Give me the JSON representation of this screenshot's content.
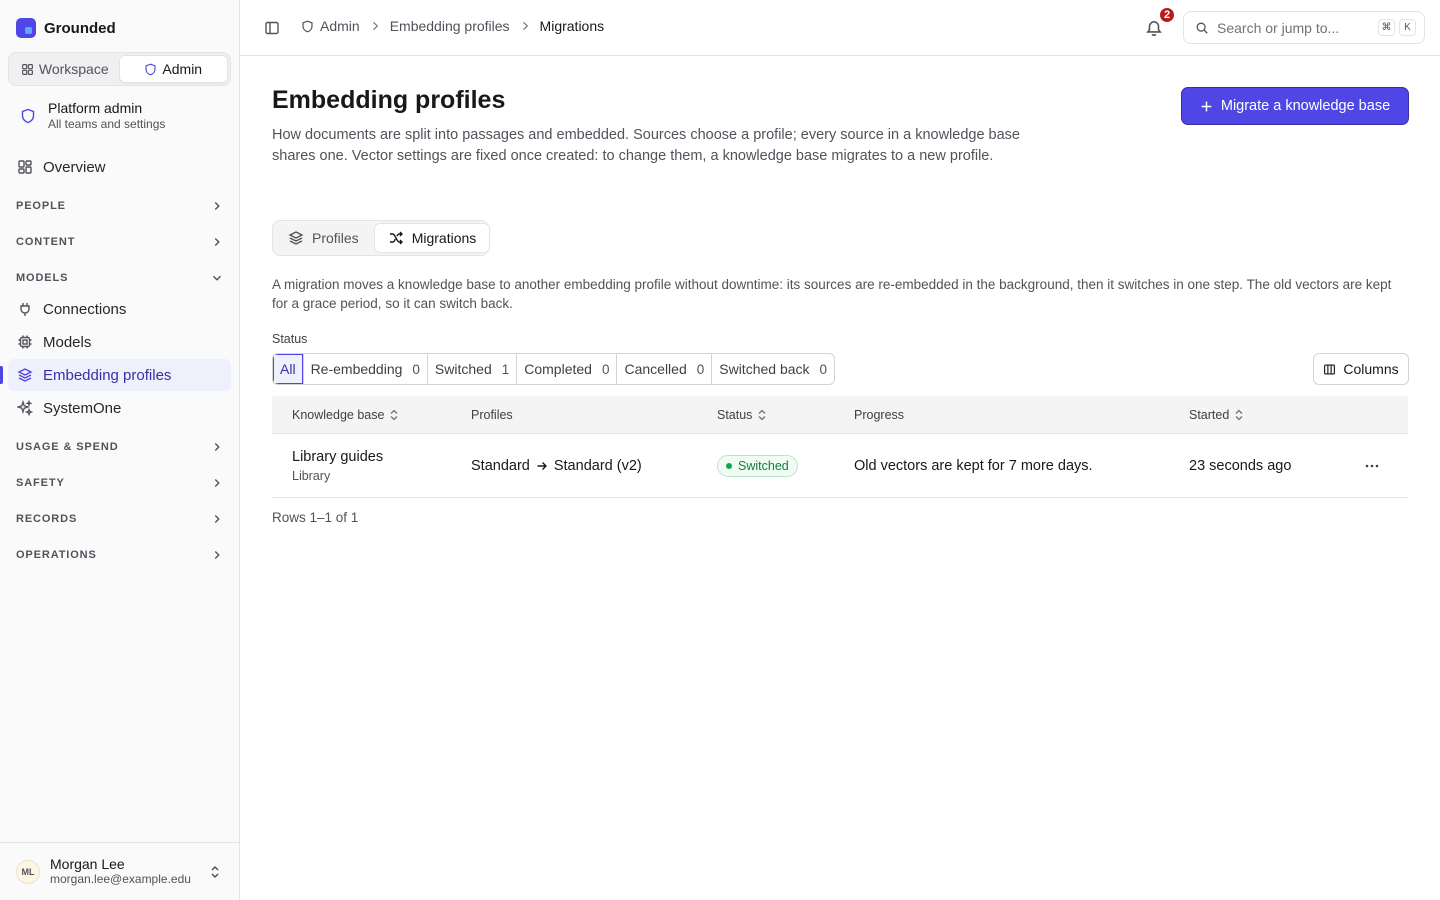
{
  "app": {
    "name": "Grounded",
    "colors": {
      "accent": "#4f46e5",
      "accent_soft": "#eef0fb",
      "success": "#16a34a",
      "danger": "#b91c1c"
    }
  },
  "sidebar": {
    "modes": [
      {
        "label": "Workspace",
        "icon": "grid-icon",
        "active": false
      },
      {
        "label": "Admin",
        "icon": "shield-icon",
        "active": true
      }
    ],
    "scope": {
      "title": "Platform admin",
      "subtitle": "All teams and settings",
      "icon": "shield-icon"
    },
    "overview": {
      "label": "Overview",
      "icon": "dashboard-icon"
    },
    "sections": {
      "people": "PEOPLE",
      "content": "CONTENT",
      "models": "MODELS",
      "usage": "USAGE & SPEND",
      "safety": "SAFETY",
      "records": "RECORDS",
      "operations": "OPERATIONS"
    },
    "models_items": [
      {
        "label": "Connections",
        "icon": "plug-icon",
        "active": false
      },
      {
        "label": "Models",
        "icon": "cpu-icon",
        "active": false
      },
      {
        "label": "Embedding profiles",
        "icon": "layers-icon",
        "active": true
      },
      {
        "label": "SystemOne",
        "icon": "sparkles-icon",
        "active": false
      }
    ],
    "user": {
      "initials": "ML",
      "name": "Morgan Lee",
      "email": "morgan.lee@example.edu"
    }
  },
  "topbar": {
    "breadcrumbs": [
      "Admin",
      "Embedding profiles",
      "Migrations"
    ],
    "notifications_count": "2",
    "search": {
      "placeholder": "Search or jump to...",
      "kbd1": "⌘",
      "kbd2": "K"
    }
  },
  "page": {
    "title": "Embedding profiles",
    "description": "How documents are split into passages and embedded. Sources choose a profile; every source in a knowledge base shares one. Vector settings are fixed once created: to change them, a knowledge base migrates to a new profile.",
    "primary_action": "Migrate a knowledge base",
    "tabs": [
      {
        "label": "Profiles",
        "icon": "layers-icon",
        "active": false
      },
      {
        "label": "Migrations",
        "icon": "shuffle-icon",
        "active": true
      }
    ],
    "intro": "A migration moves a knowledge base to another embedding profile without downtime: its sources are re-embedded in the background, then it switches in one step. The old vectors are kept for a grace period, so it can switch back."
  },
  "filters": {
    "label": "Status",
    "options": [
      {
        "label": "All",
        "count": "",
        "active": true
      },
      {
        "label": "Re-embedding",
        "count": "0",
        "active": false
      },
      {
        "label": "Switched",
        "count": "1",
        "active": false
      },
      {
        "label": "Completed",
        "count": "0",
        "active": false
      },
      {
        "label": "Cancelled",
        "count": "0",
        "active": false
      },
      {
        "label": "Switched back",
        "count": "0",
        "active": false
      }
    ],
    "columns_button": "Columns"
  },
  "table": {
    "headers": {
      "knowledge_base": "Knowledge base",
      "profiles": "Profiles",
      "status": "Status",
      "progress": "Progress",
      "started": "Started"
    },
    "rows": [
      {
        "name": "Library guides",
        "team": "Library",
        "from_profile": "Standard",
        "to_profile": "Standard (v2)",
        "status": "Switched",
        "progress": "Old vectors are kept for 7 more days.",
        "started": "23 seconds ago"
      }
    ],
    "rows_count": "Rows 1–1 of 1"
  }
}
